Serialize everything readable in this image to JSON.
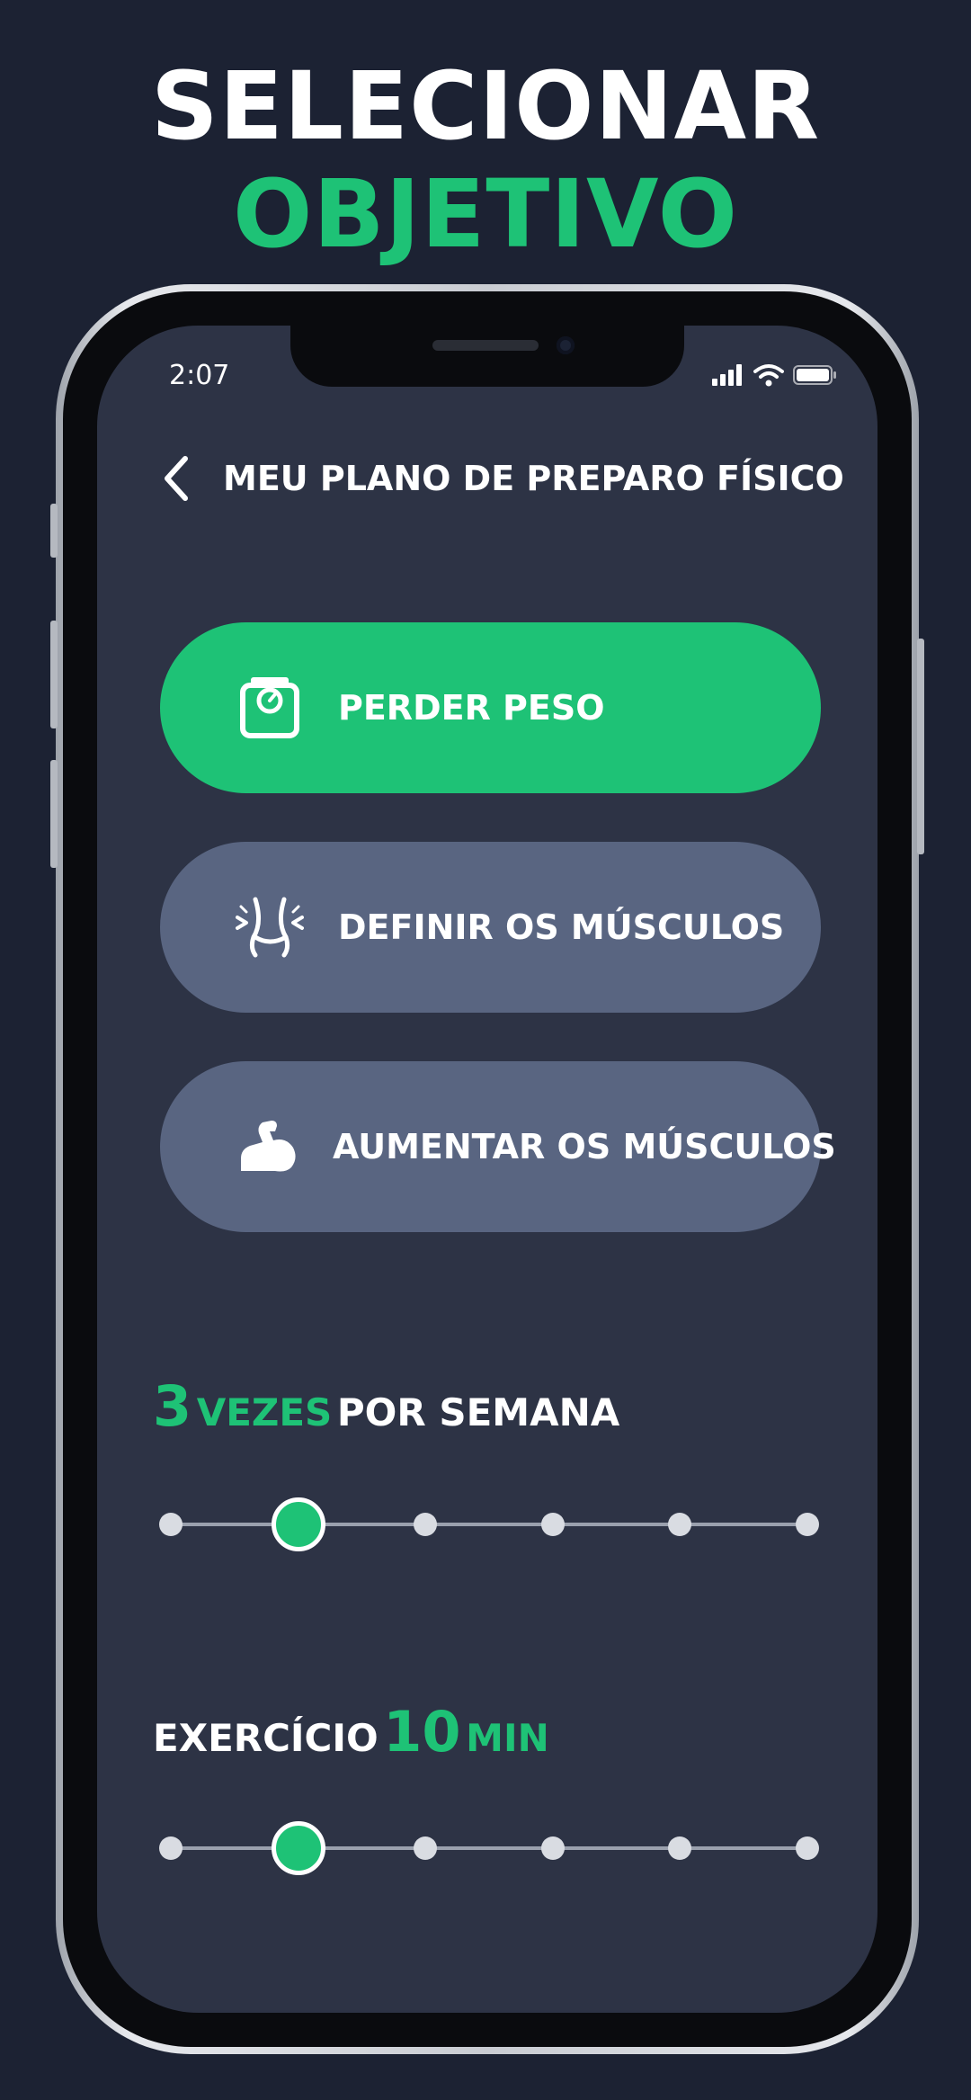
{
  "headline": {
    "line1": "SELECIONAR",
    "line2": "OBJETIVO"
  },
  "status_bar": {
    "time": "2:07",
    "icons": [
      "signal-icon",
      "wifi-icon",
      "battery-icon"
    ]
  },
  "nav": {
    "back_icon": "chevron-left-icon",
    "title": "MEU PLANO DE PREPARO FÍSICO"
  },
  "goals": [
    {
      "label": "PERDER PESO",
      "icon": "scale-icon",
      "selected": true
    },
    {
      "label": "DEFINIR OS MÚSCULOS",
      "icon": "waist-icon",
      "selected": false
    },
    {
      "label": "AUMENTAR OS MÚSCULOS",
      "icon": "flexed-arm-icon",
      "selected": false
    }
  ],
  "frequency": {
    "value": "3",
    "unit": "VEZES",
    "suffix": "POR SEMANA",
    "stops": 6,
    "selected_index": 1
  },
  "duration": {
    "prefix": "EXERCÍCIO",
    "value": "10",
    "unit": "MIN",
    "stops": 6,
    "selected_index": 1
  },
  "colors": {
    "background": "#1c2233",
    "screen": "#2d3345",
    "accent": "#1ec276",
    "card": "#596581"
  }
}
